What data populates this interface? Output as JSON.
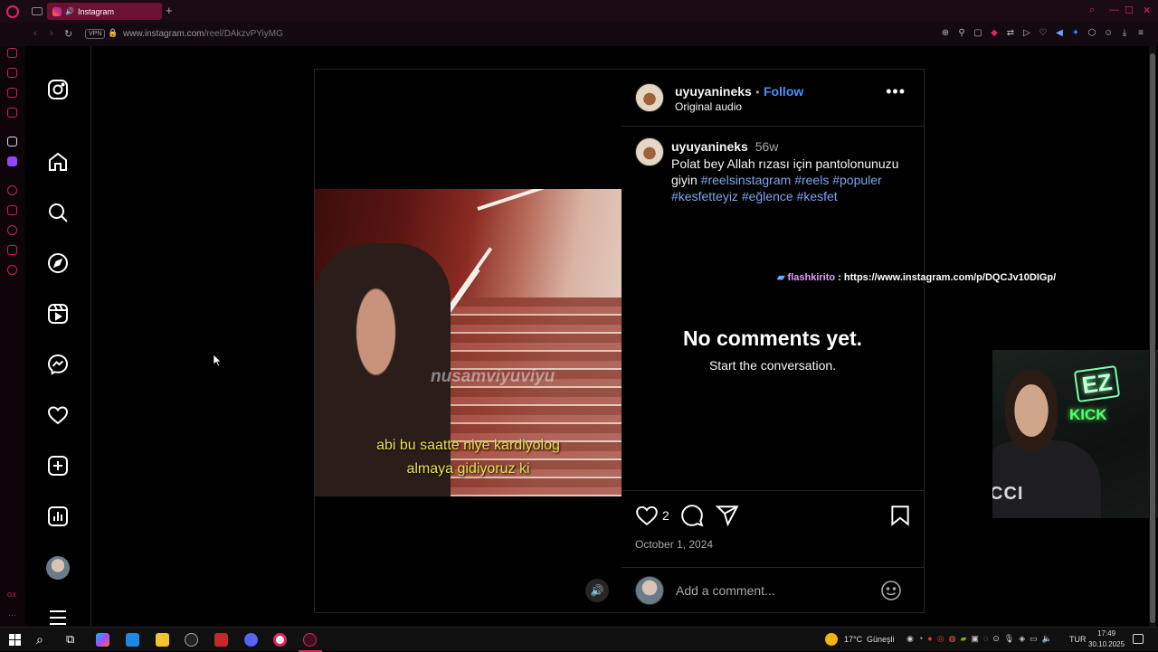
{
  "browser": {
    "tab_title": "Instagram",
    "url_domain": "www.instagram.com",
    "url_path": "/reel/DAkzvPYiyMG",
    "vpn_label": "VPN",
    "accent": "#e0245e"
  },
  "sidebar": {
    "items": [
      {
        "icon": "instagram-logo-icon"
      },
      {
        "icon": "home-icon"
      },
      {
        "icon": "search-icon"
      },
      {
        "icon": "explore-icon"
      },
      {
        "icon": "reels-icon"
      },
      {
        "icon": "messenger-icon"
      },
      {
        "icon": "heart-icon"
      },
      {
        "icon": "create-icon"
      },
      {
        "icon": "dashboard-icon"
      },
      {
        "icon": "profile-avatar"
      },
      {
        "icon": "menu-icon"
      }
    ]
  },
  "video": {
    "watermark": "nusamviyuviyu",
    "subtitle_line1": "abi bu saatte niye kardiyolog",
    "subtitle_line2": "almaya gidiyoruz ki"
  },
  "post": {
    "username": "uyuyanineks",
    "separator": "•",
    "follow_label": "Follow",
    "audio_label": "Original audio",
    "caption_time": "56w",
    "caption_text": "Polat bey Allah rızası için pantolonunuzu giyin",
    "hashtags": [
      "#reelsinstagram",
      "#reels",
      "#populer",
      "#kesfetteyiz",
      "#eğlence",
      "#kesfet"
    ],
    "no_comments_title": "No comments yet.",
    "no_comments_sub": "Start the conversation.",
    "likes": "2",
    "date": "October 1, 2024",
    "comment_placeholder": "Add a comment..."
  },
  "stream_overlay": {
    "chat_user": "flashkirito",
    "chat_separator": ":",
    "chat_message": "https://www.instagram.com/p/DQCJv10DIGp/",
    "cam_badge_1": "EZ",
    "cam_badge_2": "KICK",
    "shirt_text": "GUCCI"
  },
  "taskbar": {
    "weather_temp": "17°C",
    "weather_text": "Güneşli",
    "language": "TUR",
    "time": "17:49",
    "date": "30.10.2025"
  }
}
